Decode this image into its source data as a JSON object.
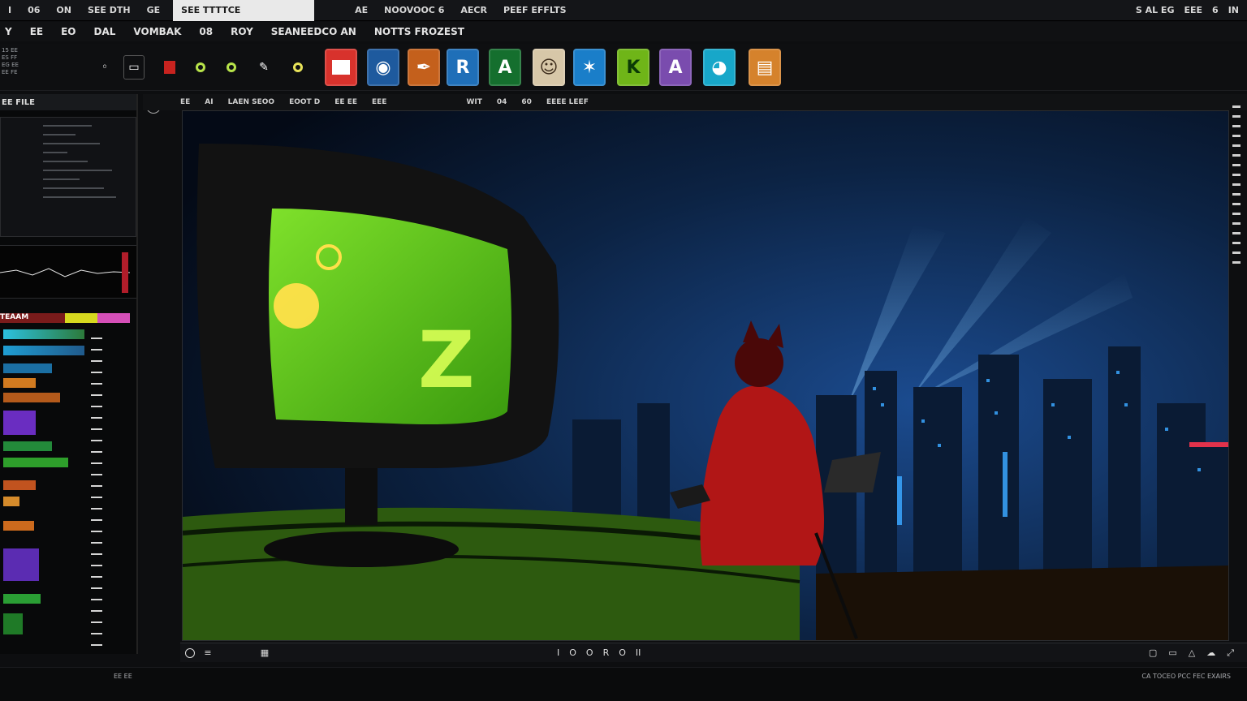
{
  "titlebar": {
    "items": [
      "I",
      "06",
      "ON",
      "SEE DTH",
      "GE",
      "SEE TTTTCE",
      "AE",
      "NOOVOOC 6",
      "AECR",
      "PEEF EFFLTS"
    ],
    "active_tab": "SEE TTTTCE",
    "right": [
      "S AL EG",
      "EEE",
      "6",
      "IN"
    ]
  },
  "menubar": {
    "items": [
      "Y",
      "EE",
      "EO",
      "DAL",
      "VOMBAK",
      "08",
      "ROY",
      "SEANEEDCO AN",
      "NOTTS FROZEST"
    ]
  },
  "toolbar": {
    "info_lines": [
      "15 EE",
      "ES FF",
      "EG EE",
      "EE FE"
    ],
    "apps": [
      {
        "label": "",
        "color": "#d8322c",
        "icon": "app-red-icon"
      },
      {
        "label": "",
        "color": "#1e5a9e",
        "icon": "app-globe-icon"
      },
      {
        "label": "",
        "color": "#c4601c",
        "icon": "app-ink-icon"
      },
      {
        "label": "R",
        "color": "#1f6fb8",
        "icon": "app-r-icon"
      },
      {
        "label": "A",
        "color": "#156f2e",
        "icon": "app-a-icon"
      },
      {
        "label": "",
        "color": "#d7c7a8",
        "icon": "app-face-icon"
      },
      {
        "label": "",
        "color": "#1a7ec9",
        "icon": "app-star-icon"
      },
      {
        "label": "K",
        "color": "#6fb518",
        "icon": "app-k-icon"
      },
      {
        "label": "A",
        "color": "#7a4cae",
        "icon": "app-brush-icon"
      },
      {
        "label": "",
        "color": "#17a7c9",
        "icon": "app-swirl-icon"
      },
      {
        "label": "",
        "color": "#d5822c",
        "icon": "app-folder-icon"
      }
    ]
  },
  "leftpanel": {
    "header": "EE FILE",
    "title_strip": "TEAAM"
  },
  "viewer": {
    "header_items": [
      "EE",
      "AI",
      "LAEN SEOO",
      "EOOT D",
      "EE EE",
      "EEE",
      "WIT",
      "04",
      "60",
      "EEEE LEEF",
      "0"
    ],
    "screen_text": "Z"
  },
  "viewer_foot": {
    "center": [
      "I",
      "O",
      "O",
      "R",
      "O",
      "II"
    ]
  },
  "statusbar": {
    "left": "EE EE",
    "right": "CA TOCEO PCC FEC EXAIRS"
  }
}
